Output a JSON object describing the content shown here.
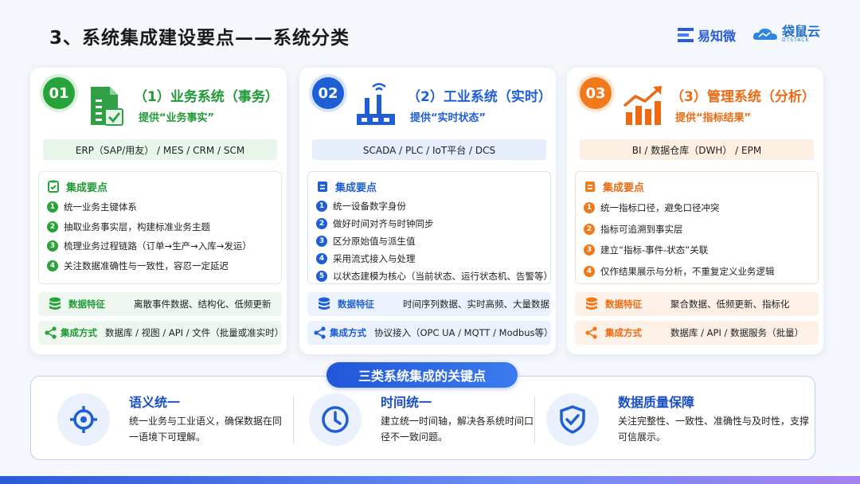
{
  "page": {
    "title": "3、系统集成建设要点——系统分类"
  },
  "logos": {
    "logo1": "易知微",
    "logo2": "袋鼠云",
    "logo2_sub": "DTSTACK"
  },
  "cards": [
    {
      "number": "01",
      "title": "（1）业务系统（事务）",
      "subtitle": "提供“业务事实”",
      "tags": "ERP（SAP/用友） / MES / CRM / SCM",
      "points_title": "集成要点",
      "points": [
        "统一业务主键体系",
        "抽取业务事实层，构建标准业务主题",
        "梳理业务过程链路（订单→生产→入库→发运）",
        "关注数据准确性与一致性，容忍一定延迟"
      ],
      "feature_label": "数据特征",
      "feature_value": "离散事件数据、结构化、低频更新",
      "method_label": "集成方式",
      "method_value": "数据库 / 视图 / API / 文件（批量或准实时）"
    },
    {
      "number": "02",
      "title": "（2）工业系统（实时）",
      "subtitle": "提供“实时状态”",
      "tags": "SCADA / PLC / IoT平台 / DCS",
      "points_title": "集成要点",
      "points": [
        "统一设备数字身份",
        "做好时间对齐与时钟同步",
        "区分原始值与派生值",
        "采用流式接入与处理",
        "以状态建模为核心（当前状态、运行状态机、告警等）"
      ],
      "feature_label": "数据特征",
      "feature_value": "时间序列数据、实时高频、大量数据",
      "method_label": "集成方式",
      "method_value": "协议接入（OPC UA / MQTT / Modbus等）"
    },
    {
      "number": "03",
      "title": "（3）管理系统（分析）",
      "subtitle": "提供“指标结果”",
      "tags": "BI / 数据仓库（DWH） / EPM",
      "points_title": "集成要点",
      "points": [
        "统一指标口径，避免口径冲突",
        "指标可追溯到事实层",
        "建立“指标-事件-状态”关联",
        "仅作结果展示与分析，不重复定义业务逻辑"
      ],
      "feature_label": "数据特征",
      "feature_value": "聚合数据、低频更新、指标化",
      "method_label": "集成方式",
      "method_value": "数据库 / API / 数据服务（批量）"
    }
  ],
  "key_points": {
    "title": "三类系统集成的关键点",
    "items": [
      {
        "title": "语义统一",
        "text": "统一业务与工业语义，确保数据在同一语境下可理解。"
      },
      {
        "title": "时间统一",
        "text": "建立统一时间轴，解决各系统时间口径不一致问题。"
      },
      {
        "title": "数据质量保障",
        "text": "关注完整性、一致性、准确性与及时性，支撑可信展示。"
      }
    ]
  },
  "colors": {
    "green": "#27a33a",
    "blue": "#1f5fd6",
    "orange": "#f07a1a",
    "panel_blue": "#2156d9"
  }
}
